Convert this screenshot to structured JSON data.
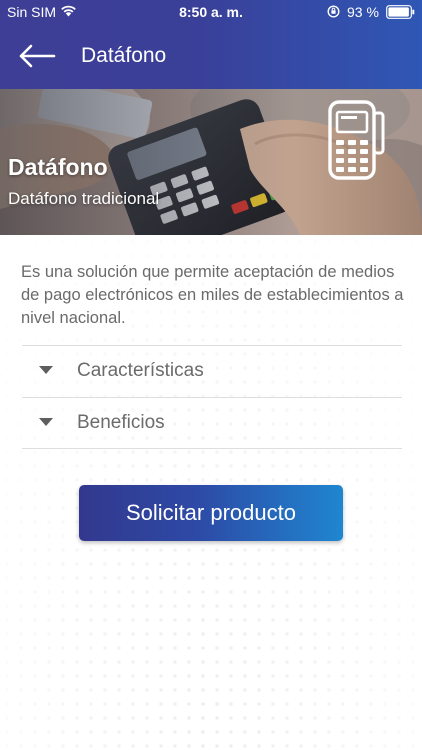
{
  "status_bar": {
    "carrier": "Sin SIM",
    "time": "8:50 a. m.",
    "battery": "93 %",
    "icons": [
      "wifi-icon",
      "rotation-lock-icon",
      "battery-icon"
    ]
  },
  "nav": {
    "back_icon": "arrow-left-icon",
    "title": "Datáfono"
  },
  "hero": {
    "title": "Datáfono",
    "subtitle": "Datáfono tradicional",
    "icon": "pos-terminal-icon"
  },
  "description": "Es una solución que permite aceptación de medios de pago electrónicos en miles de establecimientos a nivel nacional.",
  "accordion": {
    "items": [
      {
        "label": "Características",
        "icon": "caret-down-icon"
      },
      {
        "label": "Beneficios",
        "icon": "caret-down-icon"
      }
    ]
  },
  "cta": {
    "label": "Solicitar producto"
  },
  "colors": {
    "header_start": "#3e3e96",
    "header_end": "#2f57b5",
    "button_start": "#33388e",
    "button_end": "#1f86d0",
    "text_muted": "#6a6a6a"
  }
}
